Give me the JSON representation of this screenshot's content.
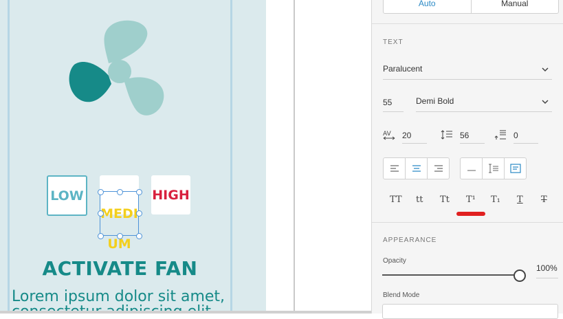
{
  "canvas": {
    "speed_buttons": {
      "low": "LOW",
      "medium_line1": "MEDI",
      "medium_line2": "UM",
      "high": "HIGH"
    },
    "title": "ACTIVATE FAN",
    "body_text": "Lorem ipsum dolor sit amet, consectetur adipiscing elit"
  },
  "panel": {
    "mode": {
      "auto": "Auto",
      "manual": "Manual"
    },
    "text_section": {
      "label": "TEXT",
      "font_family": "Paralucent",
      "font_size": "55",
      "font_weight": "Demi Bold",
      "character_spacing": "20",
      "line_spacing": "56",
      "paragraph_spacing": "0"
    },
    "case_buttons": {
      "uppercase": "TT",
      "lowercase": "tt",
      "titlecase": "Tt",
      "superscript": "T¹",
      "subscript": "T₁",
      "underline": "T",
      "strikethrough": "T"
    },
    "appearance_section": {
      "label": "APPEARANCE",
      "opacity_label": "Opacity",
      "opacity_value": "100%",
      "opacity_level": 1.0,
      "blend_mode_label": "Blend Mode"
    }
  },
  "colors": {
    "accent": "#2a89c5",
    "fan_teal": "#168a88",
    "fan_light": "#9fcfcc",
    "low": "#5cb4c4",
    "medium": "#f3cf1e",
    "high": "#d8203e",
    "highlight_underline": "#e02020"
  }
}
